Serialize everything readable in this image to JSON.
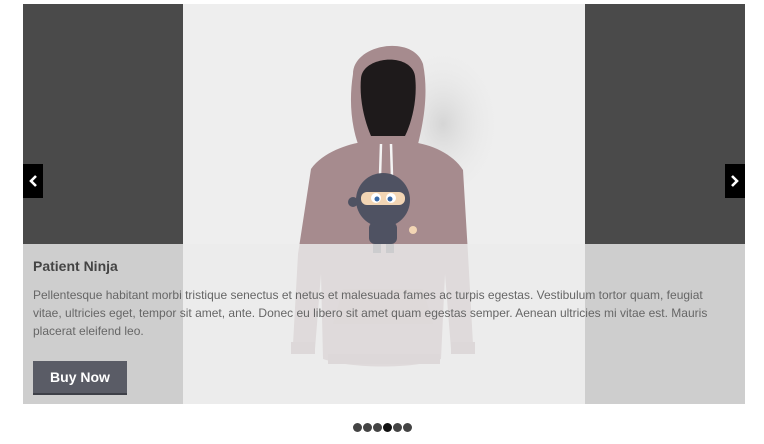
{
  "slide": {
    "title": "Patient Ninja",
    "description": "Pellentesque habitant morbi tristique senectus et netus et malesuada fames ac turpis egestas. Vestibulum tortor quam, feugiat vitae, ultricies eget, tempor sit amet, ante. Donec eu libero sit amet quam egestas semper. Aenean ultricies mi vitae est. Mauris placerat eleifend leo.",
    "button_label": "Buy Now",
    "image": "hoodie-with-ninja-print"
  },
  "controls": {
    "prev_icon": "chevron-left-icon",
    "next_icon": "chevron-right-icon"
  },
  "pager": {
    "count": 6,
    "active_index": 3
  },
  "colors": {
    "side_panel": "#4a4a4a",
    "image_bg": "#eeeeee",
    "hoodie": "#a68b8e",
    "button": "#5a5c66",
    "arrow_bg": "#000000"
  }
}
